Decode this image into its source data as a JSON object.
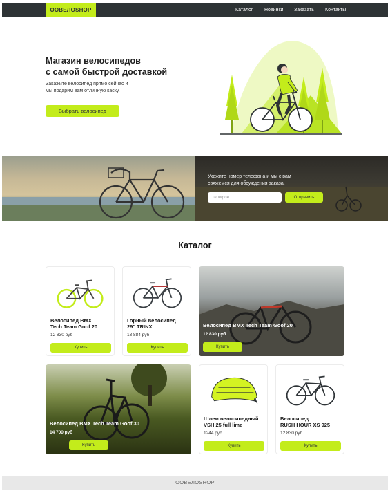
{
  "header": {
    "logo": "ООВЕЛОSHOP",
    "nav": [
      "Каталог",
      "Новинки",
      "Заказать",
      "Контакты"
    ]
  },
  "hero": {
    "title_line1": "Магазин велосипедов",
    "title_line2": "с самой быстрой доставкой",
    "subtitle_line1": "Закажите велосипед прямо сейчас и",
    "subtitle_line2_prefix": "мы подарим вам отличную ",
    "subtitle_link": "каску",
    "subtitle_line2_suffix": ".",
    "button": "Выбрать велосипед"
  },
  "banner": {
    "text_line1": "Укажите номер телефона и мы с вам",
    "text_line2": "свяжемся для обсуждения заказа.",
    "phone_placeholder": "Телефон",
    "send_button": "Отправить"
  },
  "catalog": {
    "title": "Каталог",
    "products": [
      {
        "name_line1": "Велосипед BMX",
        "name_line2": "Tech Team Goof 20",
        "price": "12 830 руб",
        "buy": "Купить"
      },
      {
        "name_line1": "Горный велосипед",
        "name_line2": "29\" TRINX",
        "price": "13 884 руб",
        "buy": "Купить"
      },
      {
        "name_line1": "Велосипед BMX Tech Team Goof 20",
        "name_line2": "",
        "price": "12 830 руб",
        "buy": "Купить"
      },
      {
        "name_line1": "Велосипед BMX Tech Team Goof 30",
        "name_line2": "",
        "price": "14 700 руб",
        "buy": "Купить"
      },
      {
        "name_line1": "Шлем велосипедный",
        "name_line2": "VSH 25 full lime",
        "price": "1244 руб",
        "buy": "Купить"
      },
      {
        "name_line1": "Велосипед",
        "name_line2": "RUSH HOUR XS 925",
        "price": "12 830 руб",
        "buy": "Купить"
      }
    ]
  },
  "footer": {
    "text": "ООВЕЛОSHOP"
  },
  "colors": {
    "accent": "#c3ec1b",
    "dark": "#2e3335"
  }
}
